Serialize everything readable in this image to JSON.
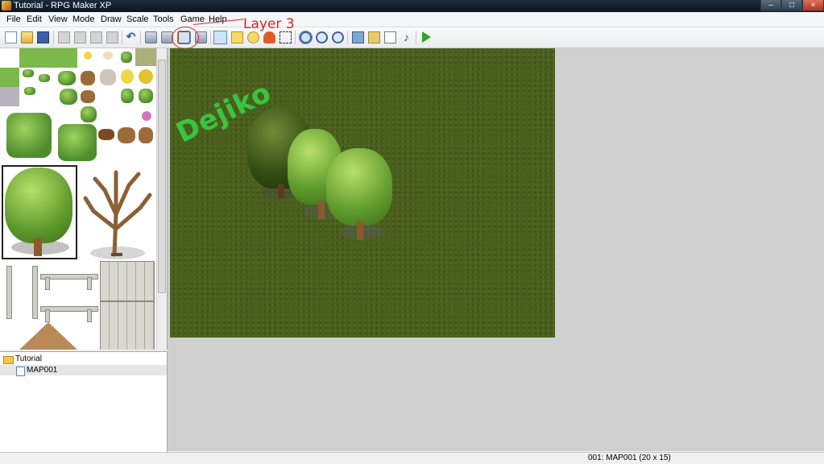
{
  "window": {
    "title": "Tutorial - RPG Maker XP"
  },
  "menu": [
    "File",
    "Edit",
    "View",
    "Mode",
    "Draw",
    "Scale",
    "Tools",
    "Game",
    "Help"
  ],
  "toolbar": {
    "icons": [
      "new-project",
      "open-project",
      "save-project",
      "cut",
      "copy",
      "paste",
      "delete",
      "undo",
      "layer-1",
      "layer-2",
      "layer-3",
      "events-layer",
      "pencil",
      "rectangle",
      "ellipse",
      "flood-fill",
      "select",
      "zoom-1-1",
      "zoom-1-2",
      "zoom-1-4",
      "database",
      "materialbase",
      "script-editor",
      "sound-test",
      "playtest"
    ],
    "selected": [
      "layer-3",
      "pencil",
      "zoom-1-1"
    ]
  },
  "annotation": {
    "text": "Layer 3",
    "color": "#d9252b"
  },
  "watermark": "Dejiko",
  "map_tree": {
    "project": "Tutorial",
    "maps": [
      "MAP001"
    ]
  },
  "status": {
    "map_info": "001: MAP001 (20 x 15)"
  }
}
